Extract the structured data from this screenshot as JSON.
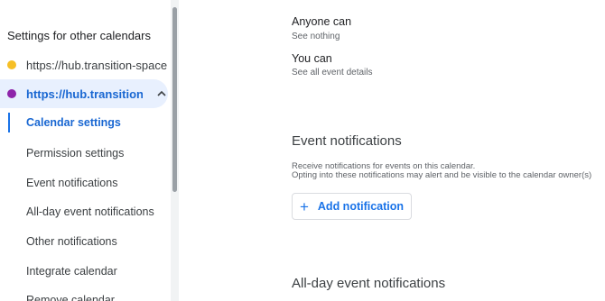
{
  "sidebar": {
    "heading": "Settings for other calendars",
    "calendars": [
      {
        "label": "https://hub.transition-space....",
        "color": "#f6bf26"
      },
      {
        "label": "https://hub.transition-...",
        "color": "#8e24aa"
      }
    ],
    "sub_items": [
      {
        "label": "Calendar settings"
      },
      {
        "label": "Permission settings"
      },
      {
        "label": "Event notifications"
      },
      {
        "label": "All-day event notifications"
      },
      {
        "label": "Other notifications"
      },
      {
        "label": "Integrate calendar"
      },
      {
        "label": "Remove calendar"
      }
    ]
  },
  "permissions": {
    "anyone_title": "Anyone can",
    "anyone_value": "See nothing",
    "you_title": "You can",
    "you_value": "See all event details"
  },
  "event_notifications": {
    "title": "Event notifications",
    "desc_line1": "Receive notifications for events on this calendar.",
    "desc_line2": "Opting into these notifications may alert and be visible to the calendar owner(s)",
    "add_button": "Add notification"
  },
  "allday_notifications": {
    "title": "All-day event notifications"
  },
  "colors": {
    "accent": "#1a73e8",
    "selected_bg": "#e8f0fe"
  }
}
